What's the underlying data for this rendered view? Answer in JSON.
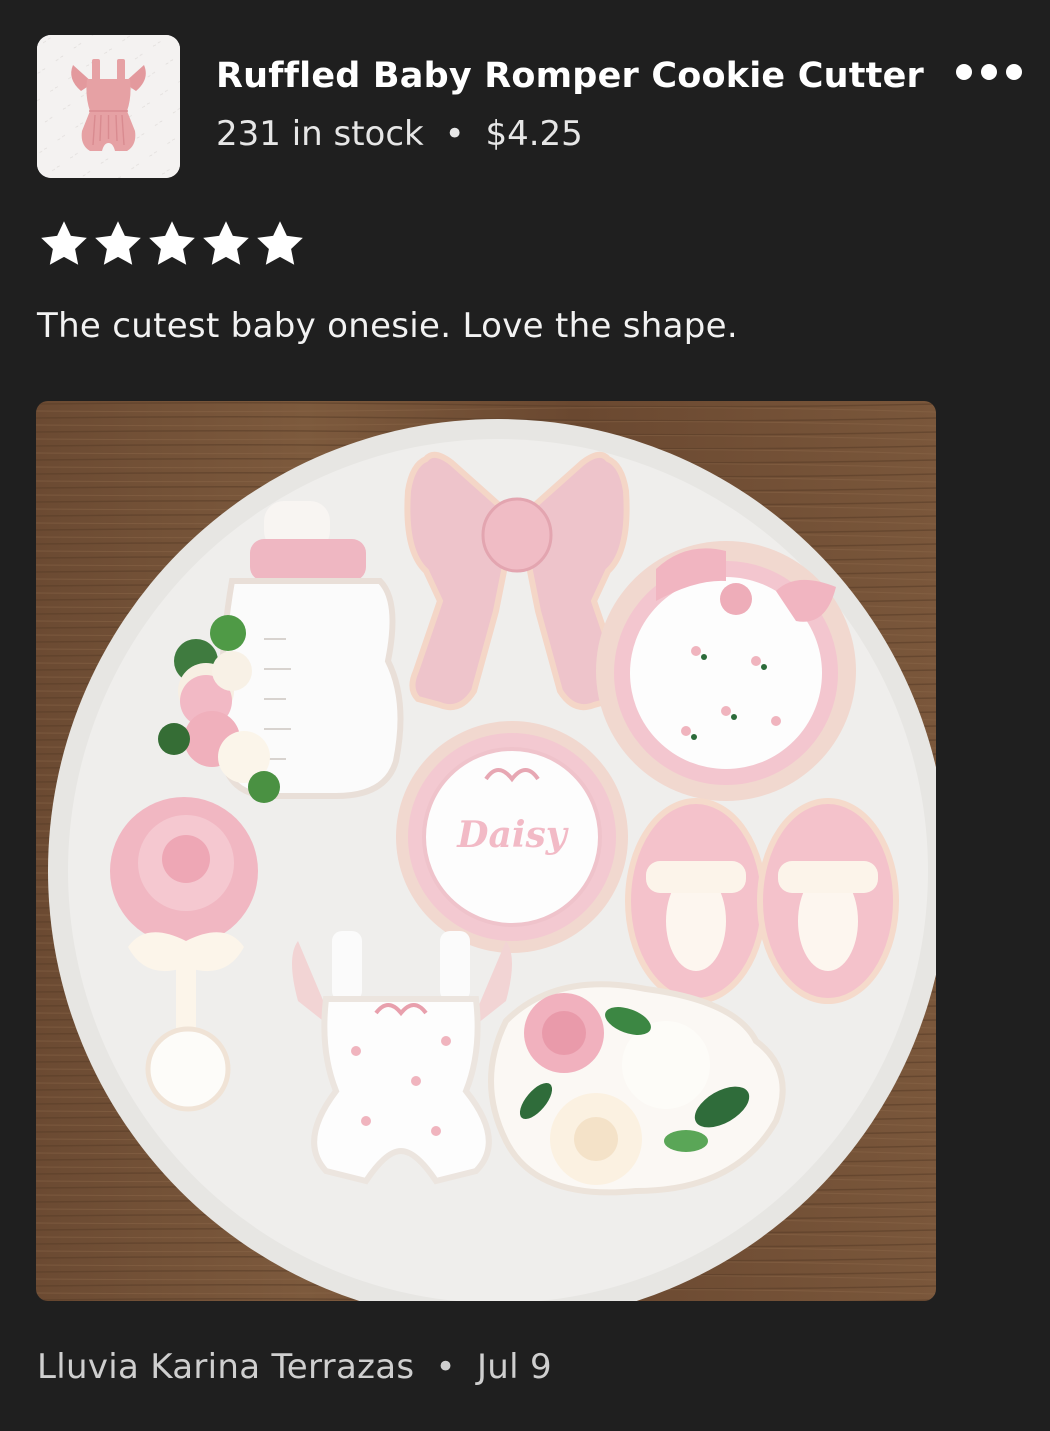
{
  "listing": {
    "title": "Ruffled Baby Romper Cookie Cutter",
    "stock": "231 in stock",
    "separator": "•",
    "price": "$4.25",
    "thumbnail_icon": "pink-romper-icon"
  },
  "more_menu": {
    "icon": "more-horizontal-icon"
  },
  "review": {
    "rating": 5,
    "rating_max": 5,
    "text": "The cutest baby onesie. Love the shape.",
    "photo_text": "Daisy",
    "reviewer": "Lluvia Karina Terrazas",
    "separator": "•",
    "date": "Jul 9"
  },
  "colors": {
    "background": "#1f1f1f",
    "text": "#ffffff",
    "muted_text": "#cfcfcf",
    "star": "#ffffff",
    "romper_pink": "#e6a1a4"
  }
}
